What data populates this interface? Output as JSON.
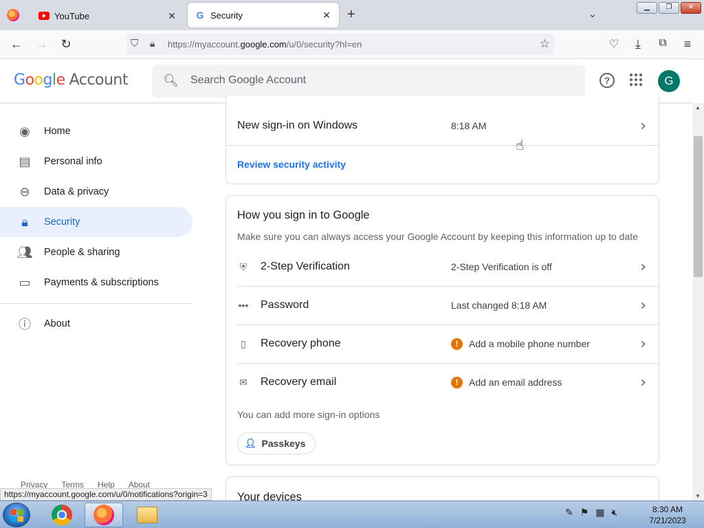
{
  "browser": {
    "tabs": [
      {
        "title": "YouTube"
      },
      {
        "title": "Security"
      }
    ],
    "url": {
      "prefix": "https://myaccount.",
      "domain": "google.com",
      "suffix": "/u/0/security?hl=en"
    },
    "status_url": "https://myaccount.google.com/u/0/notifications?origin=3"
  },
  "header": {
    "logo_word": "Google",
    "logo_suffix": "Account",
    "search_placeholder": "Search Google Account",
    "help": "?",
    "avatar_letter": "G"
  },
  "sidebar": {
    "items": [
      {
        "label": "Home",
        "icon": "account-circle-icon"
      },
      {
        "label": "Personal info",
        "icon": "id-card-icon"
      },
      {
        "label": "Data & privacy",
        "icon": "toggle-icon"
      },
      {
        "label": "Security",
        "icon": "lock-icon",
        "active": true
      },
      {
        "label": "People & sharing",
        "icon": "people-icon"
      },
      {
        "label": "Payments & subscriptions",
        "icon": "credit-card-icon"
      },
      {
        "label": "About",
        "icon": "info-icon"
      }
    ],
    "footer": [
      "Privacy",
      "Terms",
      "Help",
      "About"
    ]
  },
  "activity": {
    "event_title": "New sign-in on Windows",
    "event_time": "8:18 AM",
    "review_link": "Review security activity"
  },
  "signin": {
    "title": "How you sign in to Google",
    "subtitle": "Make sure you can always access your Google Account by keeping this information up to date",
    "rows": [
      {
        "title": "2-Step Verification",
        "value": "2-Step Verification is off",
        "warning": false
      },
      {
        "title": "Password",
        "value": "Last changed 8:18 AM",
        "warning": false
      },
      {
        "title": "Recovery phone",
        "value": "Add a mobile phone number",
        "warning": true
      },
      {
        "title": "Recovery email",
        "value": "Add an email address",
        "warning": true
      }
    ],
    "more_options": "You can add more sign-in options",
    "passkeys_label": "Passkeys"
  },
  "devices": {
    "title": "Your devices"
  },
  "taskbar": {
    "time": "8:30 AM",
    "date": "7/21/2023"
  },
  "colors": {
    "accent": "#1a73e8",
    "active_nav_bg": "#e8f0fe",
    "warning": "#e37400",
    "avatar": "#00796b"
  }
}
